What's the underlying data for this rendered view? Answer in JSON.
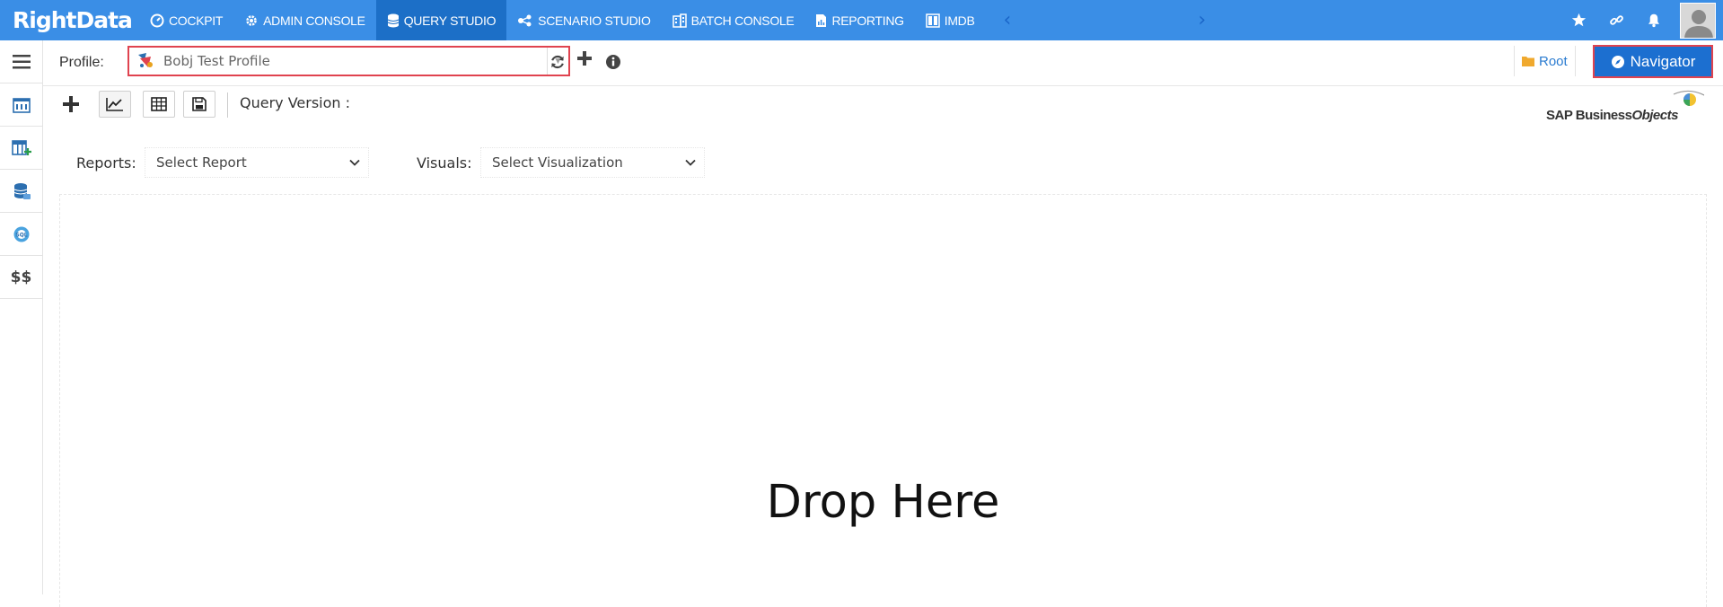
{
  "brand": {
    "logo_text": "RightData"
  },
  "nav": {
    "items": [
      {
        "label": "COCKPIT"
      },
      {
        "label": "ADMIN CONSOLE"
      },
      {
        "label": "QUERY STUDIO"
      },
      {
        "label": "SCENARIO STUDIO"
      },
      {
        "label": "BATCH CONSOLE"
      },
      {
        "label": "REPORTING"
      },
      {
        "label": "IMDB"
      }
    ],
    "prev_arrow": "‹",
    "next_arrow": "›"
  },
  "profile": {
    "label": "Profile:",
    "value": "Bobj Test Profile"
  },
  "root_link": "Root",
  "navigator_button": "Navigator",
  "toolbar": {
    "query_version_label": "Query Version :"
  },
  "vendor_logo": {
    "text_main": "SAP Business",
    "text_bold": "Objects"
  },
  "reports": {
    "label": "Reports:",
    "placeholder": "Select Report"
  },
  "visuals": {
    "label": "Visuals:",
    "placeholder": "Select Visualization"
  },
  "sidebar": {
    "money_label": "$$"
  },
  "drop_area": {
    "text": "Drop Here"
  },
  "colors": {
    "nav_bg": "#3a8ee6",
    "nav_active": "#1c6fc7",
    "accent": "#1c6fd0",
    "highlight_border": "#e0434f",
    "link": "#2a7bd0"
  }
}
